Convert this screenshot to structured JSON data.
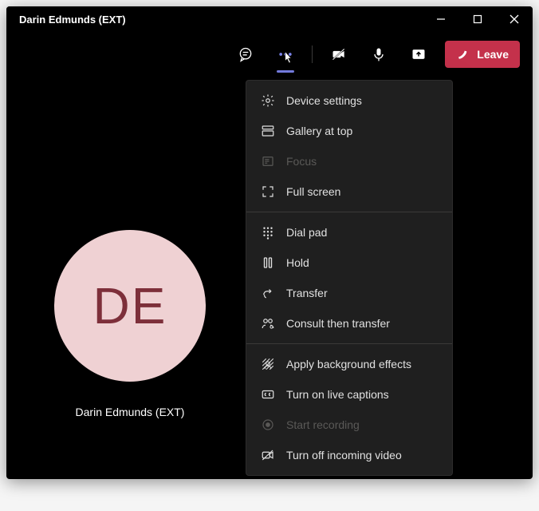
{
  "window": {
    "title": "Darin Edmunds (EXT)"
  },
  "toolbar": {
    "leave_label": "Leave"
  },
  "participant": {
    "initials": "DE",
    "name": "Darin Edmunds (EXT)"
  },
  "menu": {
    "device_settings": "Device settings",
    "gallery_at_top": "Gallery at top",
    "focus": "Focus",
    "full_screen": "Full screen",
    "dial_pad": "Dial pad",
    "hold": "Hold",
    "transfer": "Transfer",
    "consult_then_transfer": "Consult then transfer",
    "apply_background_effects": "Apply background effects",
    "turn_on_live_captions": "Turn on live captions",
    "start_recording": "Start recording",
    "turn_off_incoming_video": "Turn off incoming video"
  },
  "colors": {
    "accent": "#7b83eb",
    "leave": "#c4314b",
    "avatar_bg": "#efd1d3",
    "avatar_fg": "#7d2f3a"
  }
}
